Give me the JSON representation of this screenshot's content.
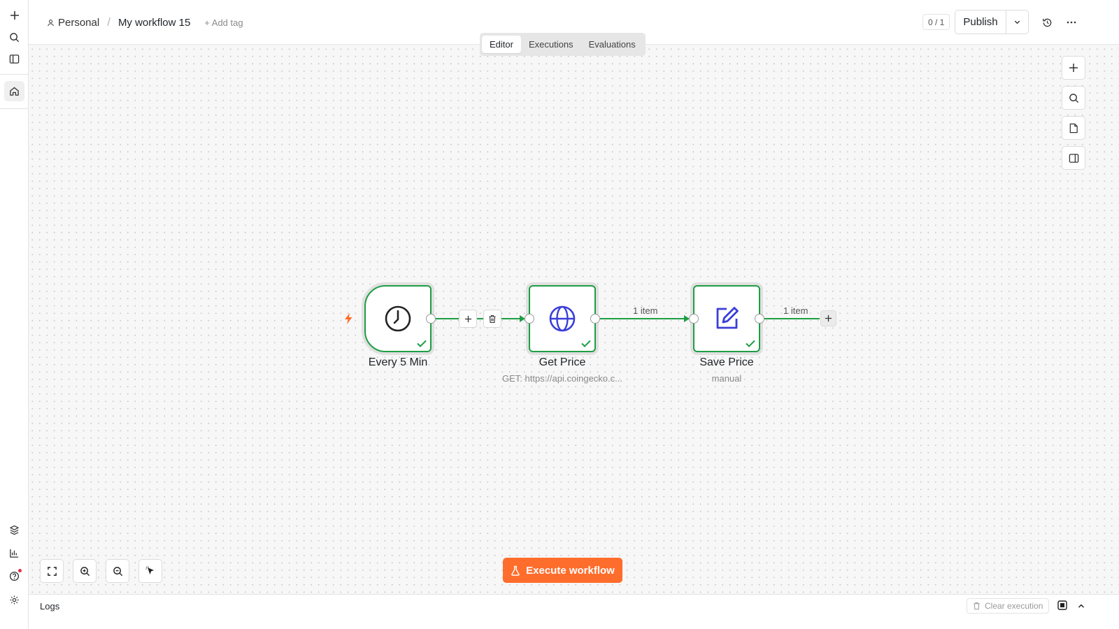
{
  "header": {
    "project": "Personal",
    "separator": "/",
    "workflow_name": "My workflow 15",
    "add_tag": "+ Add tag",
    "counter": "0 / 1",
    "publish": "Publish"
  },
  "tabs": [
    {
      "label": "Editor",
      "active": true
    },
    {
      "label": "Executions",
      "active": false
    },
    {
      "label": "Evaluations",
      "active": false
    }
  ],
  "nodes": [
    {
      "label": "Every 5 Min",
      "subtitle": "",
      "icon": "clock-icon"
    },
    {
      "label": "Get Price",
      "subtitle": "GET: https://api.coingecko.c...",
      "icon": "globe-icon"
    },
    {
      "label": "Save Price",
      "subtitle": "manual",
      "icon": "edit-icon"
    }
  ],
  "edges": {
    "get_to_save": "1 item",
    "save_out": "1 item"
  },
  "execute_button": "Execute workflow",
  "logs": {
    "title": "Logs",
    "clear": "Clear execution"
  },
  "colors": {
    "accent": "#ff6d2c",
    "success": "#1e9e44",
    "node_icon": "#3b3fd8"
  }
}
